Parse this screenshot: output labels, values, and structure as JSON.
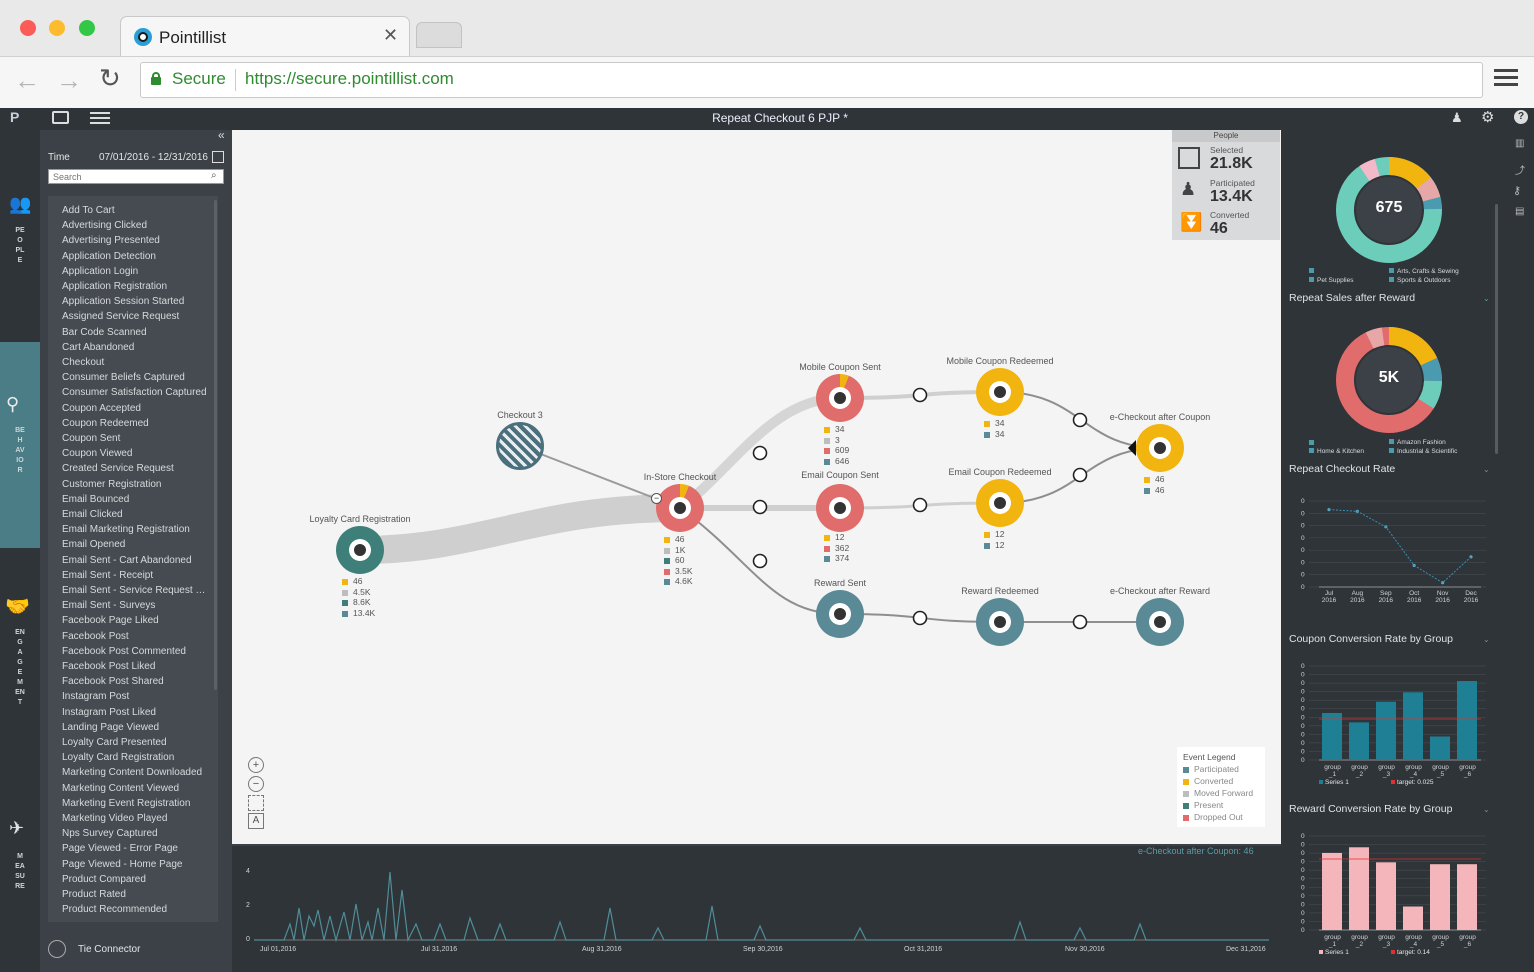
{
  "browser": {
    "tab_title": "Pointillist",
    "secure_label": "Secure",
    "url": "https://secure.pointillist.com"
  },
  "app": {
    "title": "Repeat Checkout 6 PJP *"
  },
  "rail": {
    "people": "PEOPLE",
    "behavior": "BEHAVIOR",
    "engagement": "ENGAGEMENT",
    "measure": "MEASURE"
  },
  "sidebar": {
    "time_label": "Time",
    "date_range": "07/01/2016 - 12/31/2016",
    "search_placeholder": "Search",
    "events": [
      "Add To Cart",
      "Advertising Clicked",
      "Advertising Presented",
      "Application Detection",
      "Application Login",
      "Application Registration",
      "Application Session Started",
      "Assigned Service Request",
      "Bar Code Scanned",
      "Cart Abandoned",
      "Checkout",
      "Consumer Beliefs Captured",
      "Consumer Satisfaction Captured",
      "Coupon Accepted",
      "Coupon Redeemed",
      "Coupon Sent",
      "Coupon Viewed",
      "Created Service Request",
      "Customer Registration",
      "Email Bounced",
      "Email Clicked",
      "Email Marketing Registration",
      "Email Opened",
      "Email Sent - Cart Abandoned",
      "Email Sent - Receipt",
      "Email Sent - Service Request Co...",
      "Email Sent - Surveys",
      "Facebook Page Liked",
      "Facebook Post",
      "Facebook Post Commented",
      "Facebook Post Liked",
      "Facebook Post Shared",
      "Instagram Post",
      "Instagram Post Liked",
      "Landing Page Viewed",
      "Loyalty Card Presented",
      "Loyalty Card Registration",
      "Marketing Content Downloaded",
      "Marketing Content Viewed",
      "Marketing Event Registration",
      "Marketing Video Played",
      "Nps Survey Captured",
      "Page Viewed - Error Page",
      "Page Viewed - Home Page",
      "Product Compared",
      "Product Rated",
      "Product Recommended"
    ],
    "tie_connector": "Tie Connector"
  },
  "people": {
    "header": "People",
    "selected_label": "Selected",
    "selected_value": "21.8K",
    "participated_label": "Participated",
    "participated_value": "13.4K",
    "converted_label": "Converted",
    "converted_value": "46"
  },
  "nodes": {
    "checkout3": {
      "label": "Checkout 3"
    },
    "loyalty": {
      "label": "Loyalty Card Registration",
      "stats": [
        "46",
        "4.5K",
        "8.6K",
        "13.4K"
      ]
    },
    "instore": {
      "label": "In-Store Checkout",
      "stats": [
        "46",
        "1K",
        "60",
        "3.5K",
        "4.6K"
      ]
    },
    "mobile_sent": {
      "label": "Mobile Coupon Sent",
      "stats": [
        "34",
        "3",
        "609",
        "646"
      ]
    },
    "email_sent": {
      "label": "Email Coupon Sent",
      "stats": [
        "12",
        "362",
        "374"
      ]
    },
    "reward_sent": {
      "label": "Reward Sent"
    },
    "mobile_redeemed": {
      "label": "Mobile Coupon Redeemed",
      "stats": [
        "34",
        "34"
      ]
    },
    "email_redeemed": {
      "label": "Email Coupon Redeemed",
      "stats": [
        "12",
        "12"
      ]
    },
    "reward_redeemed": {
      "label": "Reward Redeemed"
    },
    "echeckout_coupon": {
      "label": "e-Checkout after Coupon",
      "stats": [
        "46",
        "46"
      ]
    },
    "echeckout_reward": {
      "label": "e-Checkout after Reward"
    }
  },
  "event_legend": {
    "title": "Event Legend",
    "items": [
      "Participated",
      "Converted",
      "Moved Forward",
      "Present",
      "Dropped Out"
    ]
  },
  "colors": {
    "converted": "#f2b40f",
    "moved_forward": "#bdbdbd",
    "present": "#3e7f79",
    "dropped_out": "#e06c6c",
    "participated": "#5a8a96",
    "accent_teal": "#4f8d98"
  },
  "timeline": {
    "caption": "e-Checkout after Coupon: 46",
    "y_ticks": [
      "4",
      "2",
      "0"
    ],
    "x_ticks": [
      "Jul 01,2016",
      "Jul 31,2016",
      "Aug 31,2016",
      "Sep 30,2016",
      "Oct 31,2016",
      "Nov 30,2016",
      "Dec 31,2016"
    ]
  },
  "right_panel": {
    "donut1": {
      "value": "675",
      "legend": [
        "Pet Supplies",
        "Arts, Crafts & Sewing",
        "Sports & Outdoors"
      ]
    },
    "donut2_title": "Repeat Sales after Reward",
    "donut2": {
      "value": "5K",
      "legend": [
        "Home & Kitchen",
        "Amazon Fashion",
        "Industrial & Scientific"
      ]
    },
    "line_title": "Repeat Checkout Rate",
    "line_x": [
      "Jul 2016",
      "Aug 2016",
      "Sep 2016",
      "Oct 2016",
      "Nov 2016",
      "Dec 2016"
    ],
    "bar1_title": "Coupon Conversion Rate by Group",
    "bar1_x": [
      "group _1",
      "group _2",
      "group _3",
      "group _4",
      "group _5",
      "group _6"
    ],
    "bar1_legend": [
      "Series 1",
      "target: 0.025"
    ],
    "bar2_title": "Reward Conversion Rate by Group",
    "bar2_x": [
      "group _1",
      "group _2",
      "group _3",
      "group _4",
      "group _5",
      "group _6"
    ],
    "bar2_legend": [
      "Series 1",
      "target: 0.14"
    ],
    "zero": "0"
  },
  "chart_data": [
    {
      "type": "line",
      "title": "",
      "x": [
        "Jul 2016",
        "Aug 2016",
        "Sep 2016",
        "Oct 2016",
        "Nov 2016",
        "Dec 2016"
      ],
      "values": [
        0.9,
        0.88,
        0.7,
        0.25,
        0.05,
        0.35
      ]
    },
    {
      "type": "bar",
      "title": "Coupon Conversion Rate by Group",
      "categories": [
        "group _1",
        "group _2",
        "group _3",
        "group _4",
        "group _5",
        "group _6"
      ],
      "series": [
        {
          "name": "Series 1",
          "values": [
            0.5,
            0.4,
            0.62,
            0.72,
            0.25,
            0.84
          ]
        }
      ],
      "target": 0.025
    },
    {
      "type": "bar",
      "title": "Reward Conversion Rate by Group",
      "categories": [
        "group _1",
        "group _2",
        "group _3",
        "group _4",
        "group _5",
        "group _6"
      ],
      "series": [
        {
          "name": "Series 1",
          "values": [
            0.82,
            0.88,
            0.72,
            0.25,
            0.7,
            0.7
          ]
        }
      ],
      "target": 0.14
    }
  ]
}
